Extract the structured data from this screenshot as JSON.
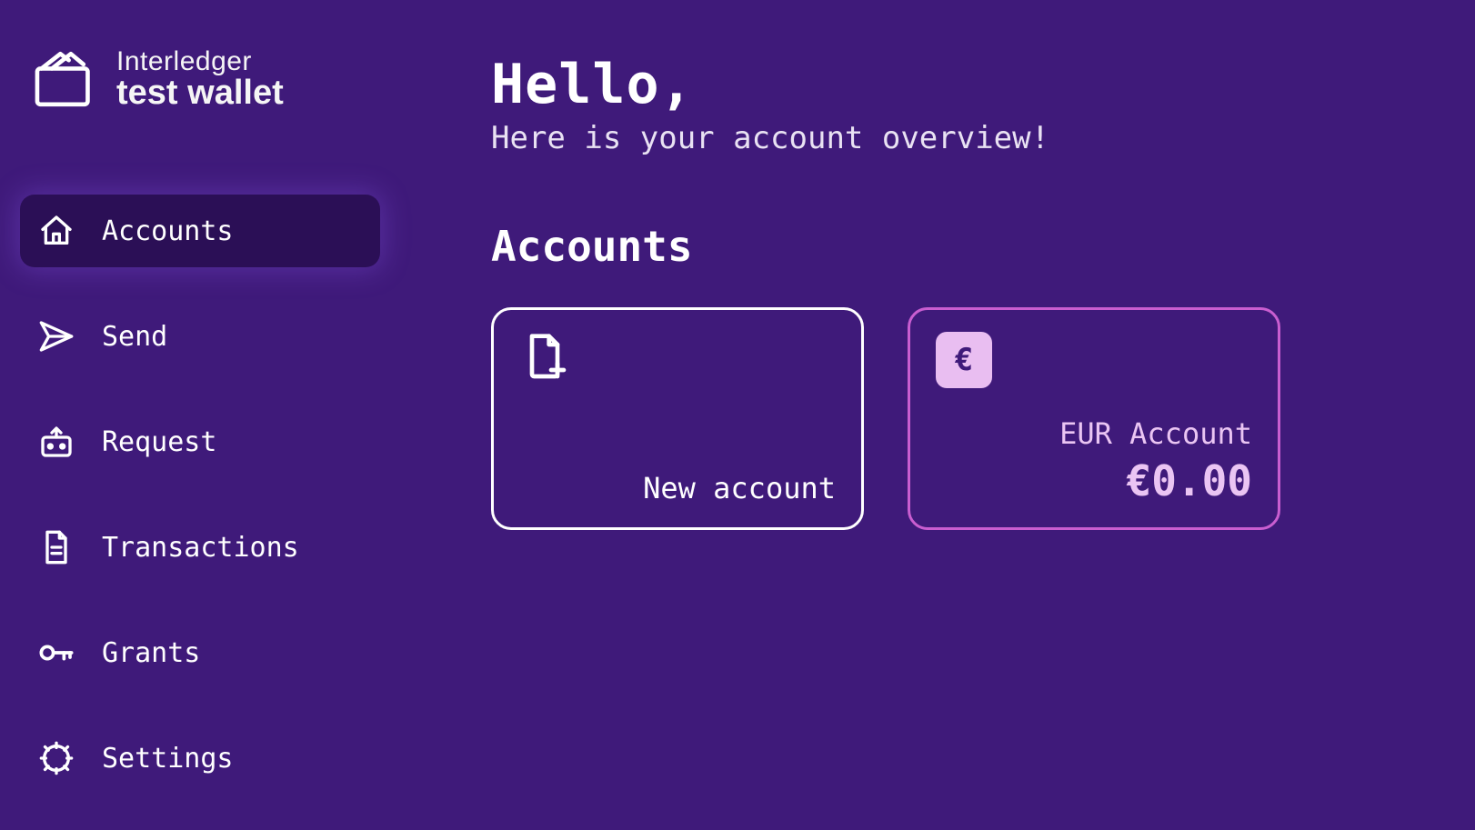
{
  "logo": {
    "line1": "Interledger",
    "line2": "test wallet"
  },
  "nav": {
    "accounts": "Accounts",
    "send": "Send",
    "request": "Request",
    "transactions": "Transactions",
    "grants": "Grants",
    "settings": "Settings"
  },
  "greeting": {
    "hello": "Hello,",
    "subtitle": "Here is your account overview!"
  },
  "section_title": "Accounts",
  "cards": {
    "new_account_label": "New account",
    "account": {
      "currency_symbol": "€",
      "name": "EUR Account",
      "balance": "€0.00"
    }
  }
}
